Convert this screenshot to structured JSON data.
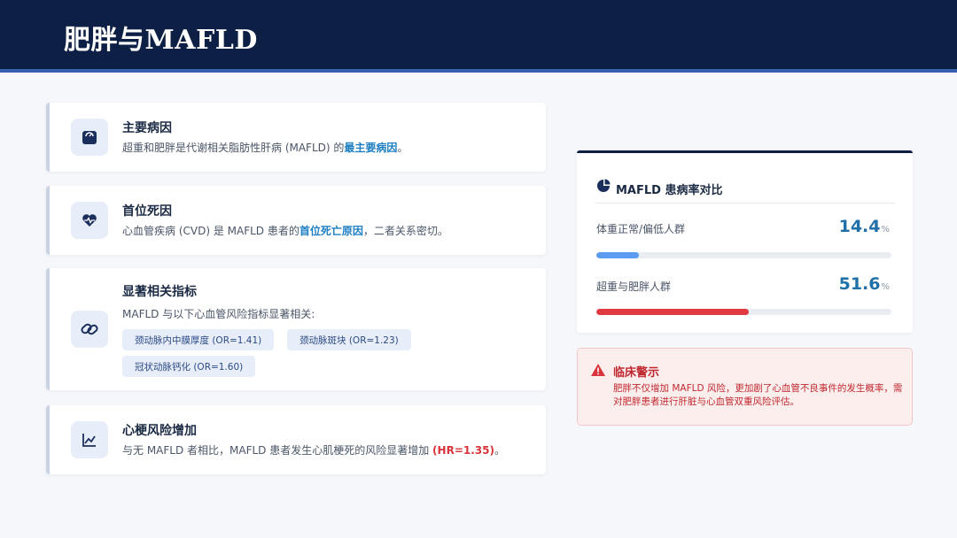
{
  "header": {
    "title": "肥胖与MAFLD"
  },
  "cards": [
    {
      "title": "主要病因",
      "desc_prefix": "超重和肥胖是代谢相关脂肪性肝病 (MAFLD) 的",
      "desc_highlight": "最主要病因",
      "desc_suffix": "。",
      "icon": "weight-scale-icon"
    },
    {
      "title": "首位死因",
      "desc_prefix": "心血管疾病 (CVD) 是 MAFLD 患者的",
      "desc_highlight": "首位死亡原因",
      "desc_suffix": "，二者关系密切。",
      "icon": "heart-pulse-icon"
    },
    {
      "title": "显著相关指标",
      "desc": "MAFLD 与以下心血管风险指标显著相关:",
      "chips": [
        "颈动脉内中膜厚度 (OR=1.41)",
        "颈动脉斑块 (OR=1.23)",
        "冠状动脉钙化 (OR=1.60)"
      ],
      "icon": "link-icon"
    },
    {
      "title": "心梗风险增加",
      "desc_prefix": "与无 MAFLD 者相比，MAFLD 患者发生心肌梗死的风险显著增加 ",
      "desc_highlight": "(HR=1.35)",
      "desc_suffix": "。",
      "icon": "line-chart-icon"
    }
  ],
  "prevalence": {
    "title": "MAFLD 患病率对比",
    "icon": "pie-chart-icon",
    "unit": "%",
    "rows": [
      {
        "label": "体重正常/偏低人群",
        "value": "14.4",
        "percent": 14.4,
        "color": "#5b9cf0"
      },
      {
        "label": "超重与肥胖人群",
        "value": "51.6",
        "percent": 51.6,
        "color": "#e03a40"
      }
    ]
  },
  "alert": {
    "title": "临床警示",
    "icon": "warning-icon",
    "text": "肥胖不仅增加 MAFLD 风险，更加剧了心血管不良事件的发生概率，需对肥胖患者进行肝脏与心血管双重风险评估。"
  },
  "colors": {
    "header_bg": "#0d1f45",
    "accent_blue": "#1e7fc2",
    "accent_red": "#d9343b"
  }
}
